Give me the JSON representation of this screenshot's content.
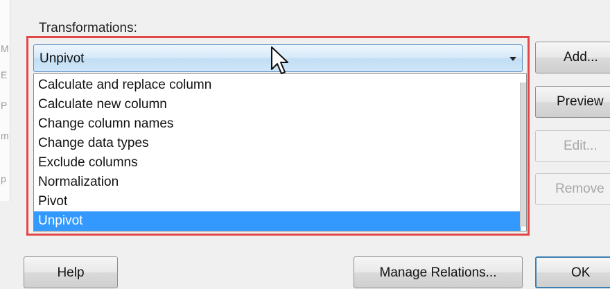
{
  "left_strip_letters": [
    "M",
    "E",
    "P",
    "m",
    "p"
  ],
  "transformations": {
    "label": "Transformations:",
    "selected_value": "Unpivot",
    "items": [
      "Calculate and replace column",
      "Calculate new column",
      "Change column names",
      "Change data types",
      "Exclude columns",
      "Normalization",
      "Pivot",
      "Unpivot"
    ],
    "selected_index": 7
  },
  "side_buttons": {
    "add": "Add...",
    "preview": "Preview",
    "edit": "Edit...",
    "remove": "Remove"
  },
  "bottom_buttons": {
    "help": "Help",
    "manage_relations": "Manage Relations...",
    "ok": "OK"
  },
  "colors": {
    "highlight_frame": "#e04848",
    "selection": "#3399ff"
  }
}
